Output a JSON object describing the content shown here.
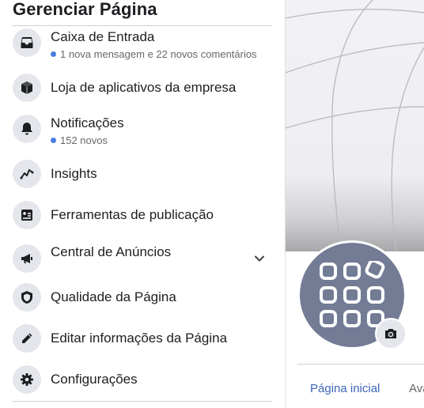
{
  "sidebar": {
    "title": "Gerenciar Página",
    "items": [
      {
        "label": "Caixa de Entrada",
        "sub": "1 nova mensagem e 22 novos comentários",
        "icon": "inbox-icon"
      },
      {
        "label": "Loja de aplicativos da empresa",
        "icon": "box-icon"
      },
      {
        "label": "Notificações",
        "sub": "152 novos",
        "icon": "bell-icon"
      },
      {
        "label": "Insights",
        "icon": "insights-chart-icon"
      },
      {
        "label": "Ferramentas de publicação",
        "icon": "publishing-tools-icon"
      },
      {
        "label": "Central de Anúncios",
        "icon": "megaphone-icon"
      },
      {
        "label": "Qualidade da Página",
        "icon": "shield-icon"
      },
      {
        "label": "Editar informações da Página",
        "icon": "pencil-icon"
      },
      {
        "label": "Configurações",
        "icon": "gear-icon"
      }
    ]
  },
  "page": {
    "tabs": [
      {
        "label": "Página inicial",
        "active": true
      },
      {
        "label": "Ava"
      }
    ]
  },
  "colors": {
    "accent": "#3c66b9",
    "dot": "#4a7ce0",
    "icon_bg": "#e4e6eb",
    "avatar": "#737b95"
  }
}
